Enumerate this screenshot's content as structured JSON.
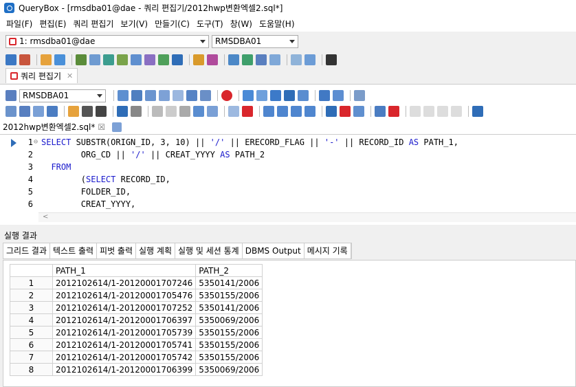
{
  "window": {
    "title": "QueryBox - [rmsdba01@dae - 쿼리 편집기/2012hwp변환엑셀2.sql*]"
  },
  "menu": [
    "파일(F)",
    "편집(E)",
    "쿼리 편집기",
    "보기(V)",
    "만들기(C)",
    "도구(T)",
    "창(W)",
    "도움말(H)"
  ],
  "connection": {
    "name": "1: rmsdba01@dae",
    "schema": "RMSDBA01"
  },
  "editor_panel_tab": {
    "label": "쿼리 편집기",
    "close": "✕"
  },
  "editor_toolbar": {
    "schema": "RMSDBA01"
  },
  "file_tab": {
    "label": "2012hwp변환엑셀2.sql*",
    "close": "☒"
  },
  "code": {
    "lines": [
      {
        "num": "1",
        "marker": "⊖",
        "segments": [
          {
            "t": "SELECT",
            "k": "kw"
          },
          {
            "t": " SUBSTR(ORIGN_ID, 3, 10) || ",
            "k": ""
          },
          {
            "t": "'/'",
            "k": "str"
          },
          {
            "t": " || ERECORD_FLAG || ",
            "k": ""
          },
          {
            "t": "'-'",
            "k": "str"
          },
          {
            "t": " || RECORD_ID ",
            "k": ""
          },
          {
            "t": "AS",
            "k": "kw"
          },
          {
            "t": " PATH_1,",
            "k": ""
          }
        ]
      },
      {
        "num": "2",
        "marker": "",
        "segments": [
          {
            "t": "        ORG_CD || ",
            "k": ""
          },
          {
            "t": "'/'",
            "k": "str"
          },
          {
            "t": " || CREAT_YYYY ",
            "k": ""
          },
          {
            "t": "AS",
            "k": "kw"
          },
          {
            "t": " PATH_2",
            "k": ""
          }
        ]
      },
      {
        "num": "3",
        "marker": "",
        "segments": [
          {
            "t": "  FROM",
            "k": "kw"
          }
        ]
      },
      {
        "num": "4",
        "marker": "",
        "segments": [
          {
            "t": "        (",
            "k": ""
          },
          {
            "t": "SELECT",
            "k": "kw"
          },
          {
            "t": " RECORD_ID,",
            "k": ""
          }
        ]
      },
      {
        "num": "5",
        "marker": "",
        "segments": [
          {
            "t": "        FOLDER_ID,",
            "k": ""
          }
        ]
      },
      {
        "num": "6",
        "marker": "",
        "segments": [
          {
            "t": "        CREAT_YYYY,",
            "k": ""
          }
        ]
      }
    ]
  },
  "results": {
    "label": "실행 결과",
    "tabs": [
      "그리드 결과",
      "텍스트 출력",
      "피벗 출력",
      "실행 계획",
      "실행 및 세션 통계",
      "DBMS Output",
      "메시지 기록"
    ],
    "columns": [
      "PATH_1",
      "PATH_2"
    ],
    "rows": [
      [
        "1",
        "2012102614/1-20120001707246",
        "5350141/2006"
      ],
      [
        "2",
        "2012102614/1-20120001705476",
        "5350155/2006"
      ],
      [
        "3",
        "2012102614/1-20120001707252",
        "5350141/2006"
      ],
      [
        "4",
        "2012102614/1-20120001706397",
        "5350069/2006"
      ],
      [
        "5",
        "2012102614/1-20120001705739",
        "5350155/2006"
      ],
      [
        "6",
        "2012102614/1-20120001705741",
        "5350155/2006"
      ],
      [
        "7",
        "2012102614/1-20120001705742",
        "5350155/2006"
      ],
      [
        "8",
        "2012102614/1-20120001706399",
        "5350069/2006"
      ]
    ]
  },
  "colors": {
    "keyword": "#1a1acc",
    "accent_red": "#d9262c",
    "app_blue": "#1f6fc5"
  }
}
